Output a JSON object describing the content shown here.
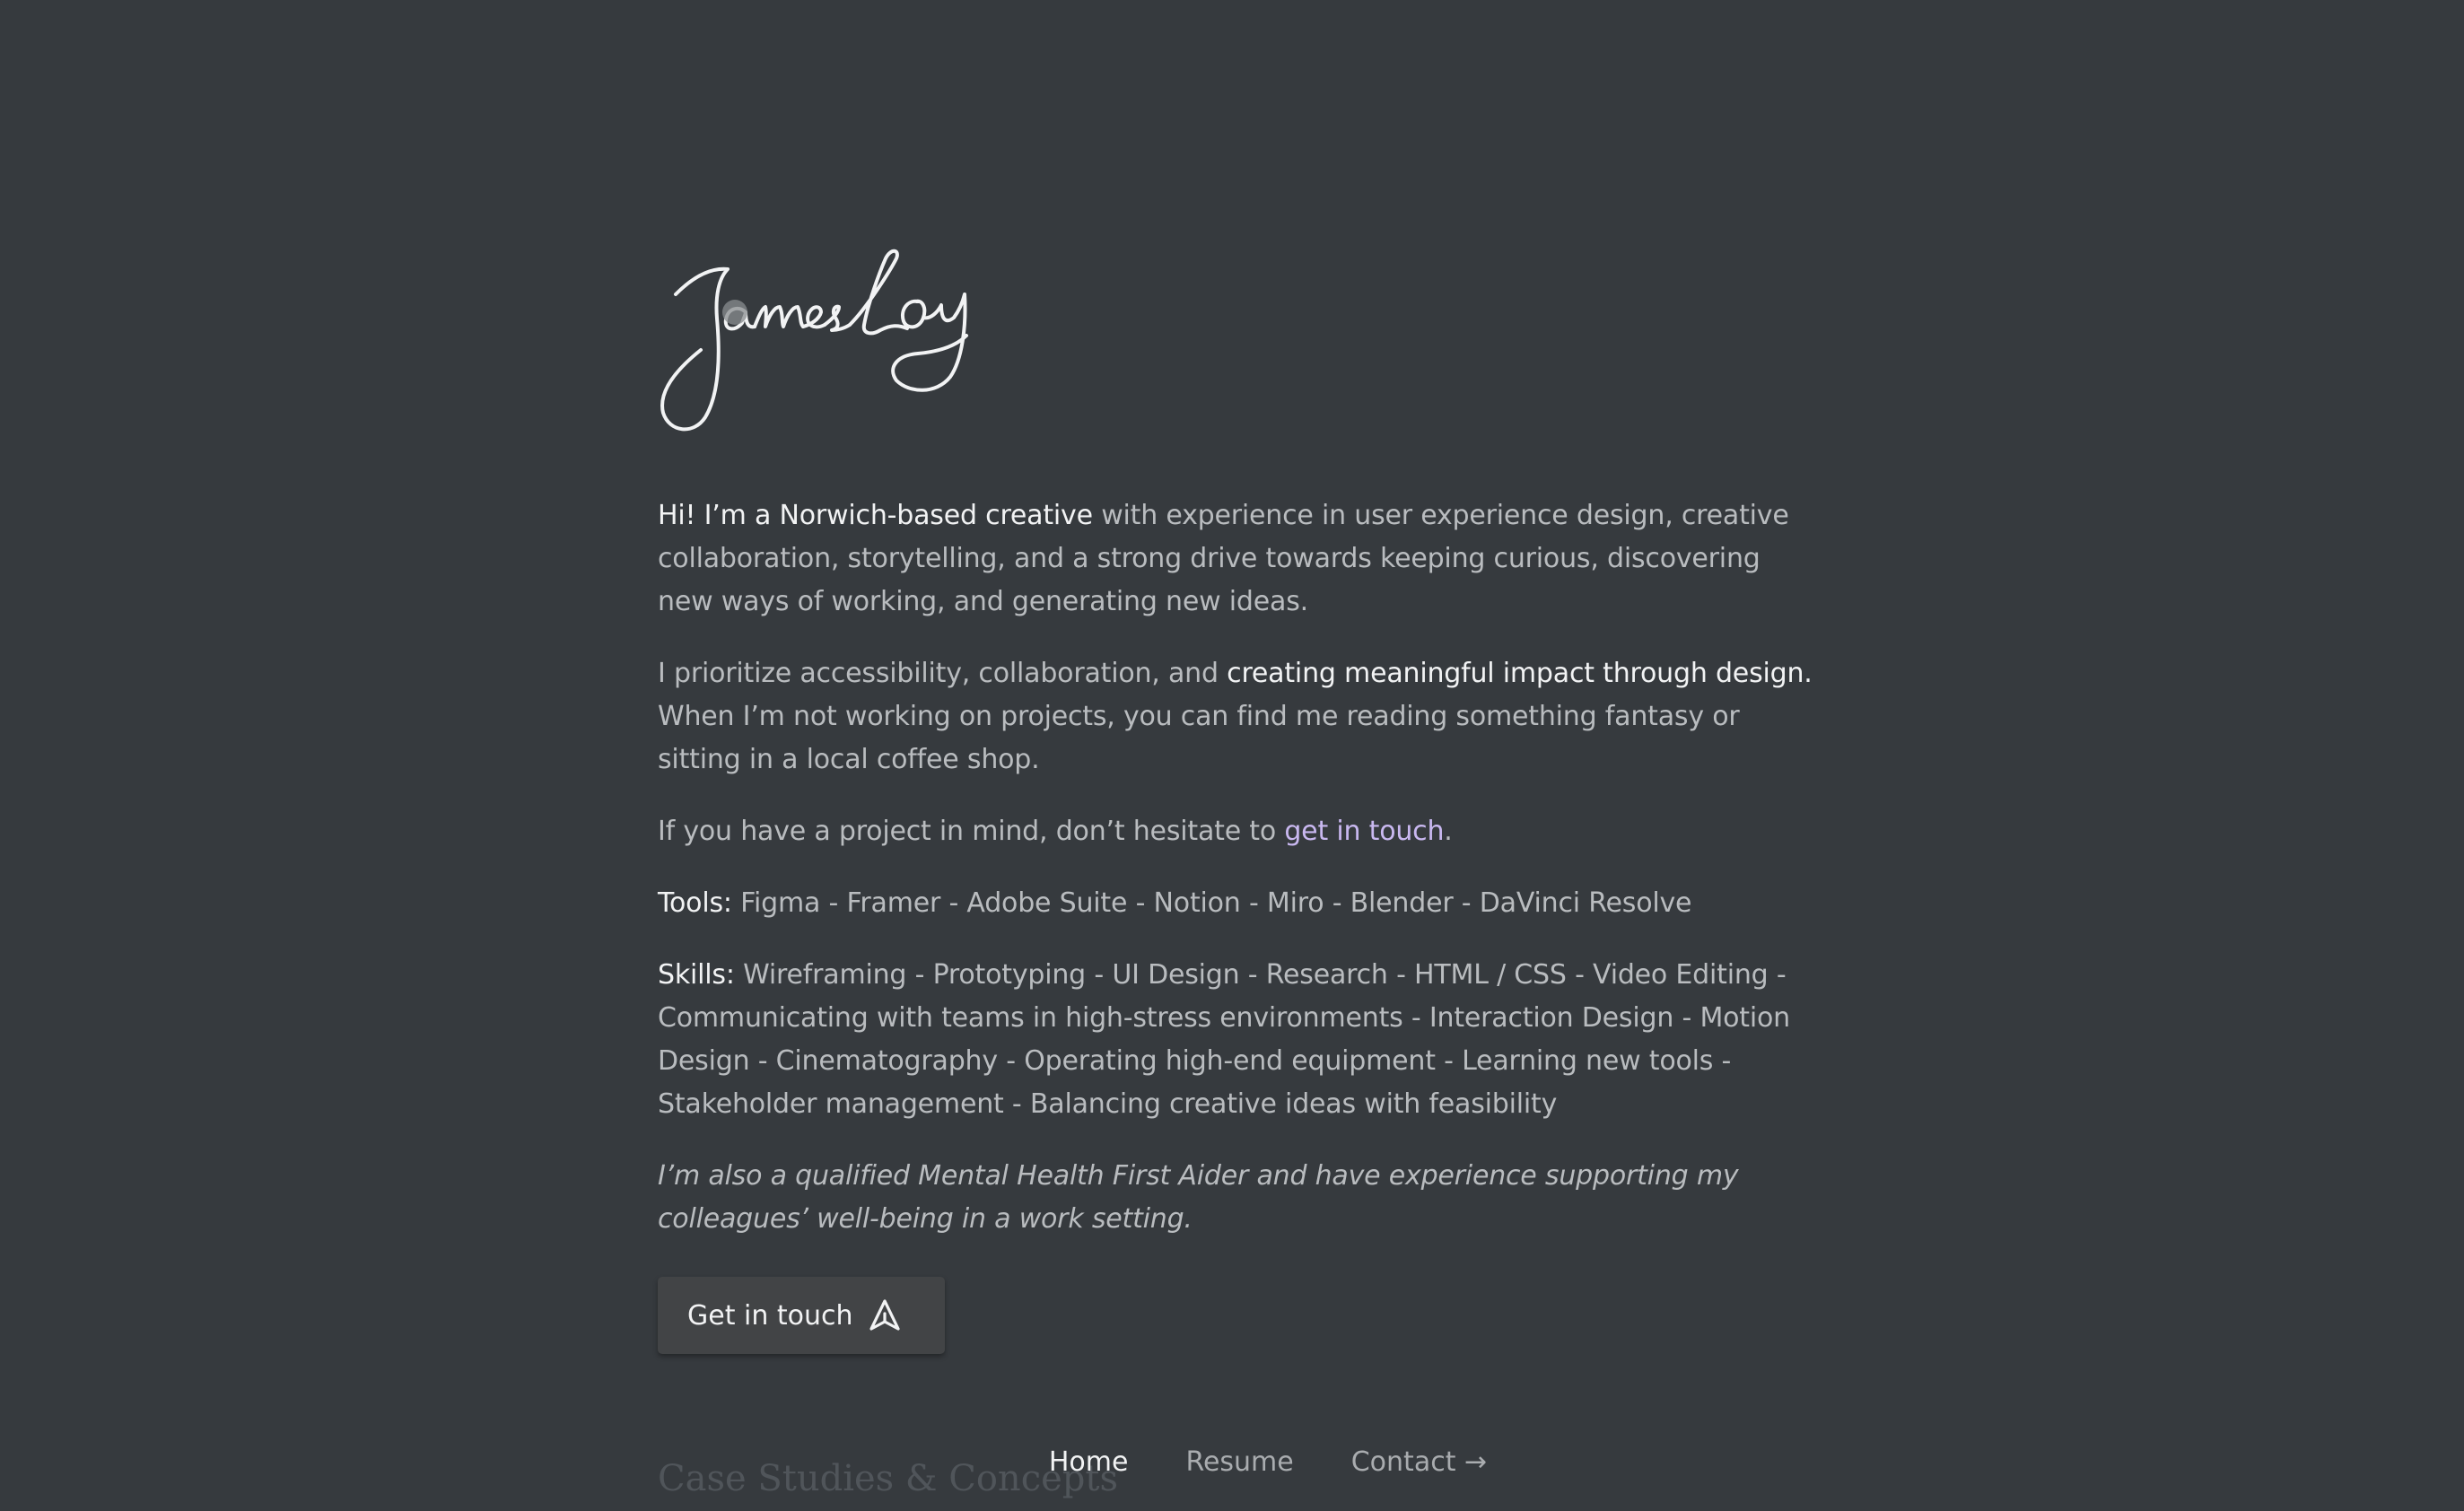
{
  "signature": {
    "text": "JamesLoy"
  },
  "intro": {
    "lead": "Hi! I’m a Norwich-based creative",
    "rest": " with experience in user experience design, creative collaboration, storytelling, and a strong drive towards keeping curious, discovering new ways of working, and generating new ideas."
  },
  "values": {
    "pre": "I prioritize accessibility, collaboration, and ",
    "highlight": "creating meaningful impact through design.",
    "post": " When I’m not working on projects, you can find me reading something fantasy or sitting in a local coffee shop."
  },
  "contact_line": {
    "pre": "If you have a project in mind, don’t hesitate to ",
    "link": "get in touch",
    "post": "."
  },
  "tools": {
    "label": "Tools:",
    "text": " Figma - Framer - Adobe Suite - Notion - Miro - Blender - DaVinci Resolve"
  },
  "skills": {
    "label": "Skills:",
    "text": " Wireframing - Prototyping - UI Design - Research - HTML / CSS - Video Editing - Communicating with teams in high-stress environments - Interaction Design - Motion Design - Cinematography - Operating high-end equipment - Learning new tools - Stakeholder management - Balancing creative ideas with feasibility"
  },
  "note": "I’m also a qualified Mental Health First Aider and have experience supporting my colleagues’ well-being in a work setting.",
  "cta": {
    "label": "Get in touch",
    "icon": "send-arrow-icon"
  },
  "next_section": {
    "heading": "Case Studies & Concepts"
  },
  "nav": {
    "home": "Home",
    "resume": "Resume",
    "contact": "Contact →",
    "active": "home"
  },
  "colors": {
    "background": "#363a3e",
    "text": "#b9bcbf",
    "highlight": "#f2f3f4",
    "link": "#c9b8f0",
    "button": "#424446"
  }
}
